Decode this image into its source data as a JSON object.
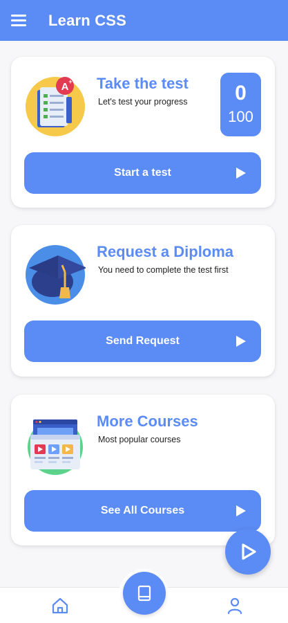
{
  "app": {
    "title": "Learn CSS",
    "accent_color": "#5b8bf5"
  },
  "cards": {
    "test": {
      "title": "Take the test",
      "description": "Let's test your progress",
      "score": "0",
      "score_total": "100",
      "button_label": "Start a test",
      "icon": "test-document-icon"
    },
    "diploma": {
      "title": "Request a Diploma",
      "description": "You need to complete the test first",
      "button_label": "Send Request",
      "icon": "graduation-cap-icon"
    },
    "courses": {
      "title": "More Courses",
      "description": "Most popular courses",
      "button_label": "See All Courses",
      "icon": "courses-browser-icon"
    }
  },
  "fab": {
    "icon": "play-icon"
  },
  "bottom_nav": {
    "items": [
      {
        "icon": "home-icon"
      },
      {
        "icon": "book-icon"
      },
      {
        "icon": "profile-icon"
      }
    ]
  }
}
